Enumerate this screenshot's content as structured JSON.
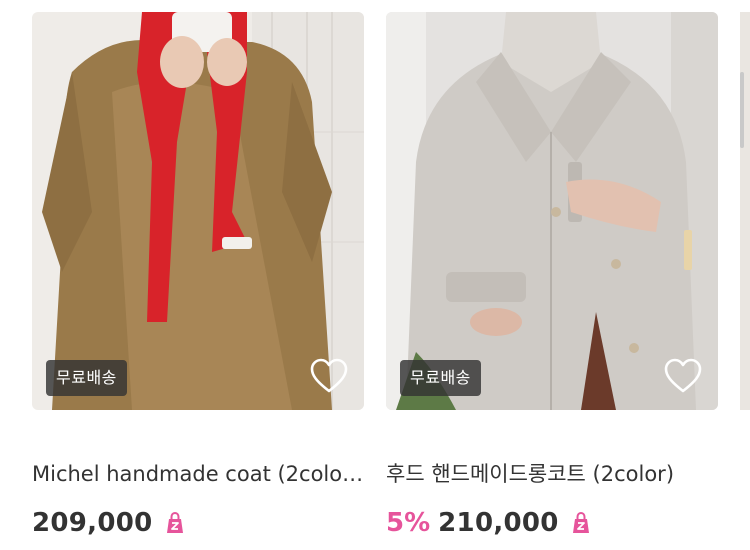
{
  "products": [
    {
      "badge": "무료배송",
      "seller": "",
      "name": "Michel handmade coat (2color)(…",
      "discount": "",
      "price": "209,000",
      "favorite_icon": "heart-outline-icon",
      "cart_icon": "shopping-bag-icon"
    },
    {
      "badge": "무료배송",
      "seller": "",
      "name": "후드 핸드메이드롱코트 (2color)",
      "discount": "5%",
      "price": "210,000",
      "favorite_icon": "heart-outline-icon",
      "cart_icon": "shopping-bag-icon"
    }
  ],
  "colors": {
    "discount": "#e6549b",
    "price": "#333333",
    "badge_bg": "#333333",
    "cart_icon": "#e6549b"
  }
}
